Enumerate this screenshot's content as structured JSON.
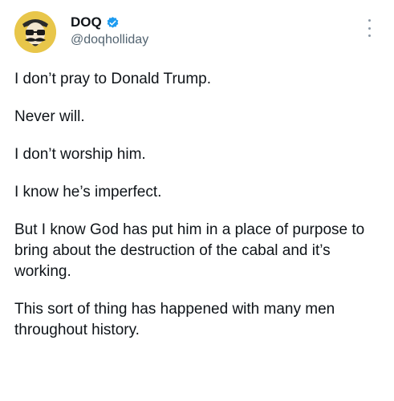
{
  "author": {
    "display_name": "DOQ",
    "handle": "@doqholliday",
    "verified_color": "#1d9bf0",
    "avatar_icon": "mustached-man-with-sunglasses-avatar"
  },
  "menu": {
    "icon": "more-vertical-icon"
  },
  "post": {
    "paragraphs": [
      "I don’t pray to Donald Trump.",
      "Never will.",
      "I don’t worship him.",
      "I know he’s imperfect.",
      "But I know God has put him in a place of purpose to bring about the destruction of the cabal and it’s working.",
      "This sort of thing has happened with many men throughout history."
    ]
  },
  "colors": {
    "text": "#0f1419",
    "secondary": "#536471",
    "background": "#ffffff"
  }
}
